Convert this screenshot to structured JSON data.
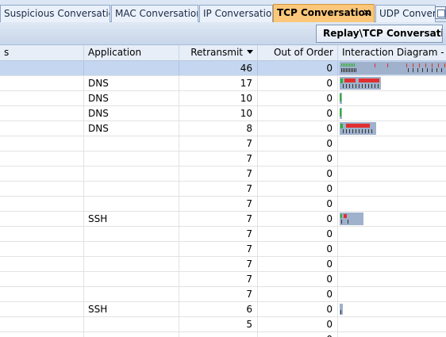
{
  "tabs": [
    {
      "label": "Suspicious Conversation",
      "active": false
    },
    {
      "label": "MAC Conversation",
      "active": false
    },
    {
      "label": "IP Conversation",
      "active": false
    },
    {
      "label": "TCP Conversation",
      "active": true,
      "close": "✕"
    },
    {
      "label": "UDP Convers",
      "active": false
    }
  ],
  "toolbar": {
    "title": "Replay\\TCP Conversation:"
  },
  "columns": {
    "col0": "s",
    "application": "Application",
    "retransmit": "Retransmit",
    "out_of_order": "Out of Order",
    "interaction": "Interaction Diagram - Gre"
  },
  "sort": {
    "column": "retransmit",
    "direction": "descending"
  },
  "colors": {
    "selected_row": "#c4d6f0",
    "active_tab": "#fbc77a",
    "diagram_bar": "#9fb1cc",
    "packet_red": "#e03030",
    "packet_green": "#30b030"
  },
  "rows": [
    {
      "app": "",
      "retransmit": "46",
      "ooo": "0",
      "selected": true,
      "diagram": "wide"
    },
    {
      "app": "DNS",
      "retransmit": "17",
      "ooo": "0",
      "diagram": "dns-large"
    },
    {
      "app": "DNS",
      "retransmit": "10",
      "ooo": "0",
      "diagram": "tiny-green"
    },
    {
      "app": "DNS",
      "retransmit": "10",
      "ooo": "0",
      "diagram": "tiny-green"
    },
    {
      "app": "DNS",
      "retransmit": "8",
      "ooo": "0",
      "diagram": "dns-medium"
    },
    {
      "app": "",
      "retransmit": "7",
      "ooo": "0",
      "diagram": ""
    },
    {
      "app": "",
      "retransmit": "7",
      "ooo": "0",
      "diagram": ""
    },
    {
      "app": "",
      "retransmit": "7",
      "ooo": "0",
      "diagram": ""
    },
    {
      "app": "",
      "retransmit": "7",
      "ooo": "0",
      "diagram": ""
    },
    {
      "app": "",
      "retransmit": "7",
      "ooo": "0",
      "diagram": ""
    },
    {
      "app": "SSH",
      "retransmit": "7",
      "ooo": "0",
      "diagram": "ssh"
    },
    {
      "app": "",
      "retransmit": "7",
      "ooo": "0",
      "diagram": ""
    },
    {
      "app": "",
      "retransmit": "7",
      "ooo": "0",
      "diagram": ""
    },
    {
      "app": "",
      "retransmit": "7",
      "ooo": "0",
      "diagram": ""
    },
    {
      "app": "",
      "retransmit": "7",
      "ooo": "0",
      "diagram": ""
    },
    {
      "app": "",
      "retransmit": "7",
      "ooo": "0",
      "diagram": ""
    },
    {
      "app": "SSH",
      "retransmit": "6",
      "ooo": "0",
      "diagram": "ssh-small"
    },
    {
      "app": "",
      "retransmit": "5",
      "ooo": "0",
      "diagram": ""
    },
    {
      "app": "",
      "retransmit": "",
      "ooo": "0",
      "diagram": ""
    }
  ]
}
